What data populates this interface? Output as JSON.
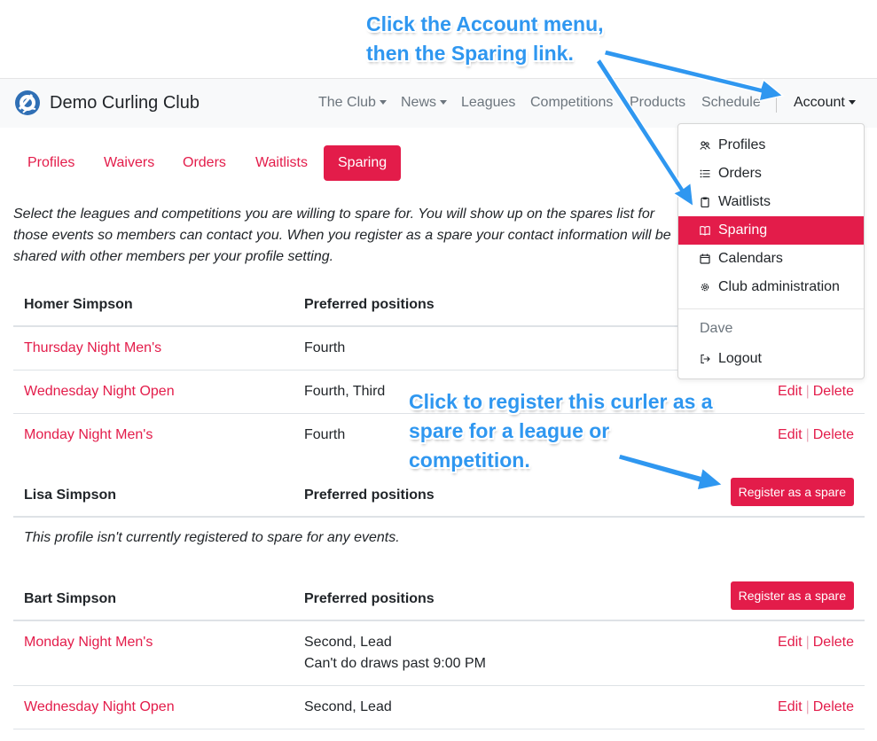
{
  "brand": {
    "name": "Demo Curling Club"
  },
  "nav": {
    "items": [
      {
        "label": "The Club",
        "dropdown": true
      },
      {
        "label": "News",
        "dropdown": true
      },
      {
        "label": "Leagues",
        "dropdown": false
      },
      {
        "label": "Competitions",
        "dropdown": false
      },
      {
        "label": "Products",
        "dropdown": false
      },
      {
        "label": "Schedule",
        "dropdown": false
      }
    ],
    "account": "Account"
  },
  "tabs": [
    "Profiles",
    "Waivers",
    "Orders",
    "Waitlists",
    "Sparing"
  ],
  "active_tab": "Sparing",
  "intro": "Select the leagues and competitions you are willing to spare for. You will show up on the spares list for those events so members can contact you. When you register as a spare your contact information will be shared with other members per your profile setting.",
  "table": {
    "positions_header": "Preferred positions"
  },
  "profiles": [
    {
      "name": "Homer Simpson",
      "rows": [
        {
          "event": "Thursday Night Men's",
          "positions": "Fourth"
        },
        {
          "event": "Wednesday Night Open",
          "positions": "Fourth, Third"
        },
        {
          "event": "Monday Night Men's",
          "positions": "Fourth"
        }
      ]
    },
    {
      "name": "Lisa Simpson",
      "empty_note": "This profile isn't currently registered to spare for any events."
    },
    {
      "name": "Bart Simpson",
      "rows": [
        {
          "event": "Monday Night Men's",
          "positions": "Second, Lead",
          "note": "Can't do draws past 9:00 PM"
        },
        {
          "event": "Wednesday Night Open",
          "positions": "Second, Lead"
        }
      ]
    }
  ],
  "actions": {
    "edit": "Edit",
    "delete": "Delete",
    "separator": "|",
    "register": "Register as a spare"
  },
  "dropdown": {
    "items": [
      {
        "label": "Profiles",
        "icon": "people-icon"
      },
      {
        "label": "Orders",
        "icon": "list-icon"
      },
      {
        "label": "Waitlists",
        "icon": "clipboard-icon"
      },
      {
        "label": "Sparing",
        "icon": "book-icon",
        "active": true
      },
      {
        "label": "Calendars",
        "icon": "calendar-icon"
      },
      {
        "label": "Club administration",
        "icon": "gear-icon"
      }
    ],
    "user": "Dave",
    "logout": "Logout",
    "logout_icon": "logout-icon"
  },
  "callouts": {
    "top": [
      "Click the Account menu,",
      "then the Sparing link."
    ],
    "mid": [
      "Click to register this curler as a",
      "spare for a league or",
      "competition."
    ]
  },
  "colors": {
    "accent": "#e31c4a",
    "callout": "#2f97f0",
    "navbar_bg": "#f8f9fa"
  }
}
